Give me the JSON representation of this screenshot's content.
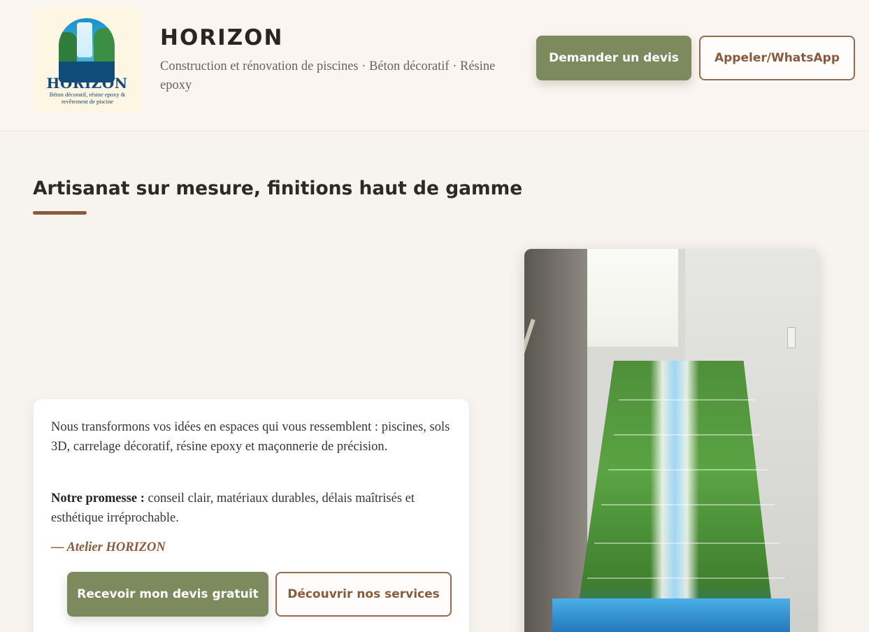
{
  "header": {
    "logo": {
      "name": "HORIZON",
      "tagline": "Béton décoratif, résine epoxy & revêtement de piscine",
      "icon": "waterfall-logo-icon"
    },
    "title": "HORIZON",
    "subtitle": "Construction et rénovation de piscines · Béton décoratif · Résine epoxy",
    "quote_button": "Demander un devis",
    "call_button": "Appeler/WhatsApp"
  },
  "section": {
    "title": "Artisanat sur mesure, finitions haut de gamme"
  },
  "card": {
    "paragraph1": "Nous transformons vos idées en espaces qui vous ressemblent : piscines, sols 3D, carrelage décoratif, résine epoxy et maçonnerie de précision.",
    "promise_label": "Notre promesse :",
    "promise_text": " conseil clair, matériaux durables, délais maîtrisés et esthétique irréprochable.",
    "signature": "— Atelier HORIZON",
    "free_quote_button": "Recevoir mon devis gratuit",
    "services_button": "Découvrir nos services"
  },
  "photo": {
    "subject": "waterfall-3d-staircase-photo"
  },
  "colors": {
    "accent_green": "#7c8a5e",
    "accent_brown": "#8a5a3c",
    "background": "#f7f3ef"
  }
}
